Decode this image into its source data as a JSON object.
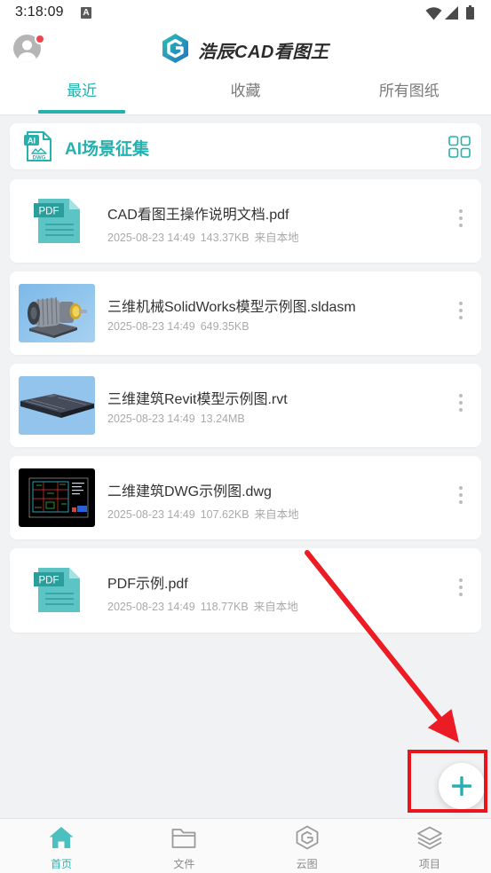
{
  "status_bar": {
    "time": "3:18:09",
    "notification_icon": "A",
    "icons": [
      "wifi-icon",
      "signal-icon",
      "battery-icon"
    ]
  },
  "header": {
    "avatar_icon": "user-avatar-icon",
    "has_notification_dot": true,
    "logo_icon": "app-logo-icon",
    "app_name": "浩辰CAD看图王"
  },
  "tabs": [
    {
      "label": "最近",
      "active": true
    },
    {
      "label": "收藏",
      "active": false
    },
    {
      "label": "所有图纸",
      "active": false
    }
  ],
  "ai_banner": {
    "icon": "ai-dwg-icon",
    "icon_tag": "AI",
    "icon_caption": "DWG",
    "title": "AI场景征集",
    "right_icon": "grid-view-icon"
  },
  "files": [
    {
      "name": "CAD看图王操作说明文档.pdf",
      "date": "2025-08-23 14:49",
      "size": "143.37KB",
      "source": "来自本地",
      "thumbnail": "pdf-icon",
      "thumb_label": "PDF"
    },
    {
      "name": "三维机械SolidWorks模型示例图.sldasm",
      "date": "2025-08-23 14:49",
      "size": "649.35KB",
      "thumbnail": "machine-thumbnail"
    },
    {
      "name": "三维建筑Revit模型示例图.rvt",
      "date": "2025-08-23 14:49",
      "size": "13.24MB",
      "thumbnail": "building-thumbnail"
    },
    {
      "name": "二维建筑DWG示例图.dwg",
      "date": "2025-08-23 14:49",
      "size": "107.62KB",
      "source": "来自本地",
      "thumbnail": "dwg-drawing-thumbnail"
    },
    {
      "name": "PDF示例.pdf",
      "date": "2025-08-23 14:49",
      "size": "118.77KB",
      "source": "来自本地",
      "thumbnail": "pdf-icon",
      "thumb_label": "PDF"
    }
  ],
  "fab": {
    "icon": "plus-icon"
  },
  "annotation": {
    "arrow_color": "#e8151c",
    "box_color": "#e8151c"
  },
  "bottom_nav": [
    {
      "label": "首页",
      "icon": "home-icon",
      "active": true
    },
    {
      "label": "文件",
      "icon": "folder-icon",
      "active": false
    },
    {
      "label": "云图",
      "icon": "cloud-drawing-icon",
      "active": false
    },
    {
      "label": "项目",
      "icon": "layers-icon",
      "active": false
    }
  ],
  "colors": {
    "accent": "#26b1af",
    "background": "#f1f2f4",
    "card": "#ffffff",
    "title_text": "#333333",
    "meta_text": "#aaaaaa",
    "notification_dot": "#f0464b"
  }
}
